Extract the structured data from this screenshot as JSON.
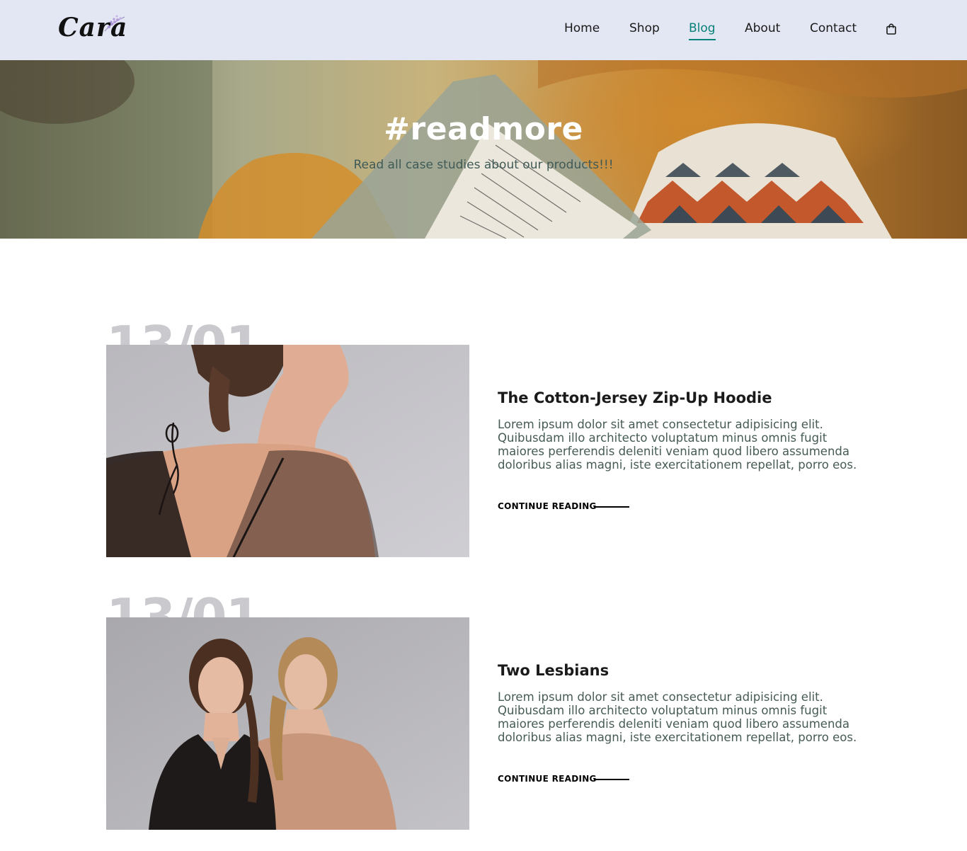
{
  "brand": {
    "logo_text": "Cara"
  },
  "nav": {
    "items": [
      {
        "label": "Home",
        "active": false
      },
      {
        "label": "Shop",
        "active": false
      },
      {
        "label": "Blog",
        "active": true
      },
      {
        "label": "About",
        "active": false
      },
      {
        "label": "Contact",
        "active": false
      }
    ],
    "cart_icon": "shopping-bag-icon"
  },
  "hero": {
    "title": "#readmore",
    "subtitle": "Read all case studies about our products!!!"
  },
  "posts": [
    {
      "date": "13/01",
      "title": "The Cotton-Jersey Zip-Up Hoodie",
      "body": "Lorem ipsum dolor sit amet consectetur adipisicing elit. Quibusdam illo architecto voluptatum minus omnis fugit maiores perferendis deleniti veniam quod libero assumenda doloribus alias magni, iste exercitationem repellat, porro eos.",
      "link": "CONTINUE READING"
    },
    {
      "date": "13/01",
      "title": "Two Lesbians",
      "body": "Lorem ipsum dolor sit amet consectetur adipisicing elit. Quibusdam illo architecto voluptatum minus omnis fugit maiores perferendis deleniti veniam quod libero assumenda doloribus alias magni, iste exercitationem repellat, porro eos.",
      "link": "CONTINUE READING"
    }
  ],
  "colors": {
    "header_bg": "#e3e6f3",
    "accent": "#088178",
    "date_watermark": "#c9c9ce"
  }
}
